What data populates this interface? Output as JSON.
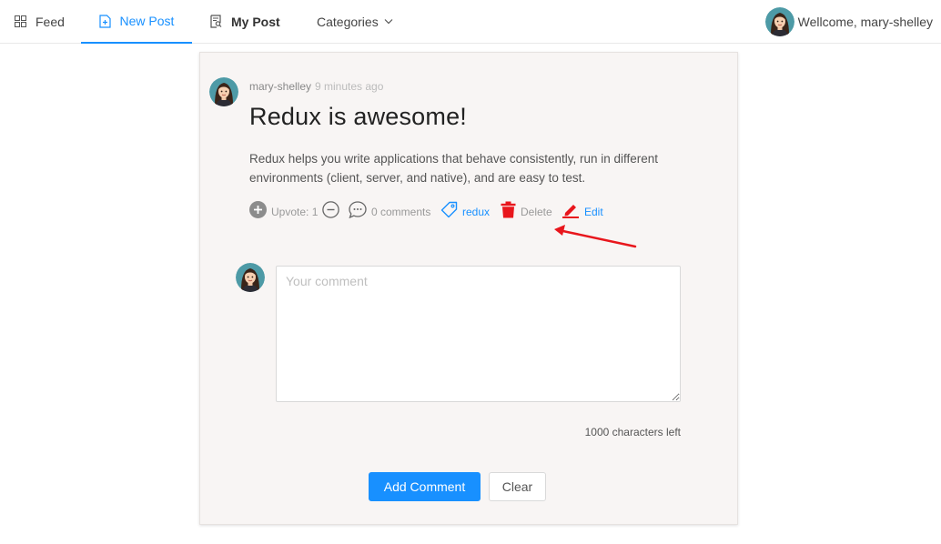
{
  "nav": {
    "feed": "Feed",
    "new_post": "New Post",
    "my_post": "My Post",
    "categories": "Categories",
    "welcome": "Wellcome, mary-shelley",
    "active_color": "#1890ff"
  },
  "post": {
    "author": "mary-shelley",
    "time": "9 minutes ago",
    "title": "Redux is awesome!",
    "body": "Redux helps you write applications that behave consistently, run in different environments (client, server, and native), and are easy to test.",
    "upvote_label": "Upvote: 1",
    "comments_label": "0 comments",
    "tag": "redux",
    "delete_label": "Delete",
    "edit_label": "Edit",
    "delete_color": "#e8161c",
    "annotation_arrow_color": "#e8161c"
  },
  "comment": {
    "placeholder": "Your comment",
    "chars_left": "1000 characters left",
    "add_button": "Add Comment",
    "clear_button": "Clear"
  }
}
